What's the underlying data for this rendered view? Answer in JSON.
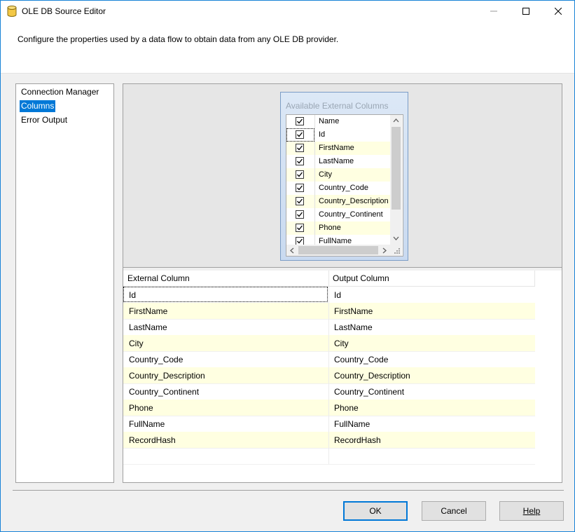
{
  "window": {
    "title": "OLE DB Source Editor"
  },
  "header": {
    "description": "Configure the properties used by a data flow to obtain data from any OLE DB provider."
  },
  "nav": {
    "items": [
      "Connection Manager",
      "Columns",
      "Error Output"
    ],
    "selected_index": 1
  },
  "available_columns": {
    "title": "Available External Columns",
    "header_label": "Name",
    "items": [
      "Id",
      "FirstName",
      "LastName",
      "City",
      "Country_Code",
      "Country_Description",
      "Country_Continent",
      "Phone",
      "FullName"
    ]
  },
  "mapping_grid": {
    "headers": [
      "External Column",
      "Output Column"
    ],
    "rows": [
      [
        "Id",
        "Id"
      ],
      [
        "FirstName",
        "FirstName"
      ],
      [
        "LastName",
        "LastName"
      ],
      [
        "City",
        "City"
      ],
      [
        "Country_Code",
        "Country_Code"
      ],
      [
        "Country_Description",
        "Country_Description"
      ],
      [
        "Country_Continent",
        "Country_Continent"
      ],
      [
        "Phone",
        "Phone"
      ],
      [
        "FullName",
        "FullName"
      ],
      [
        "RecordHash",
        "RecordHash"
      ]
    ]
  },
  "buttons": {
    "ok": "OK",
    "cancel": "Cancel",
    "help": "Help"
  },
  "colors": {
    "selection": "#0078d7",
    "alt_row": "#ffffe1",
    "window_border": "#1883d7"
  }
}
